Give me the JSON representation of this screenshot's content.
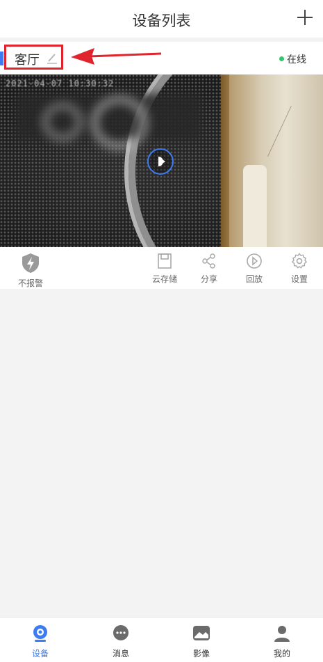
{
  "header": {
    "title": "设备列表",
    "add_icon": "plus-icon"
  },
  "device": {
    "name": "客厅",
    "edit_icon": "pencil-icon",
    "status": "在线",
    "status_color": "#2fc86b",
    "timestamp": "2021-04-07  10:30:32"
  },
  "actions": {
    "alarm_label": "不报警",
    "cloud_label": "云存储",
    "share_label": "分享",
    "playback_label": "回放",
    "settings_label": "设置"
  },
  "tabbar": {
    "tabs": [
      {
        "label": "设备",
        "icon": "camera-icon",
        "active": true
      },
      {
        "label": "消息",
        "icon": "chat-bubble-icon",
        "active": false
      },
      {
        "label": "影像",
        "icon": "image-icon",
        "active": false
      },
      {
        "label": "我的",
        "icon": "user-icon",
        "active": false
      }
    ]
  },
  "colors": {
    "accent": "#3d7cf0",
    "highlight": "#e0242e"
  }
}
